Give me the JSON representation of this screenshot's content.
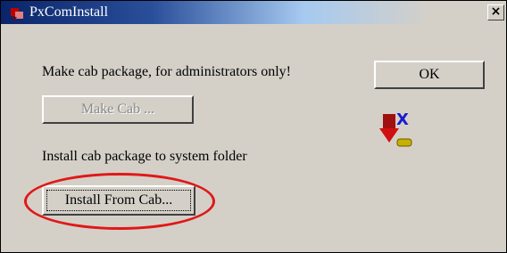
{
  "window": {
    "title": "PxComInstall",
    "close_glyph": "×",
    "title_icon": "app-icon"
  },
  "main": {
    "make_cab_label": "Make cab package, for administrators only!",
    "make_cab_button": "Make Cab ...",
    "install_label": "Install cab package to system folder",
    "install_button": "Install From Cab...",
    "ok_button": "OK",
    "install_icon_letter": "X"
  },
  "colors": {
    "dialog_bg": "#d4d0c8",
    "title_bar": "#0a246a",
    "highlight": "#e01818"
  }
}
